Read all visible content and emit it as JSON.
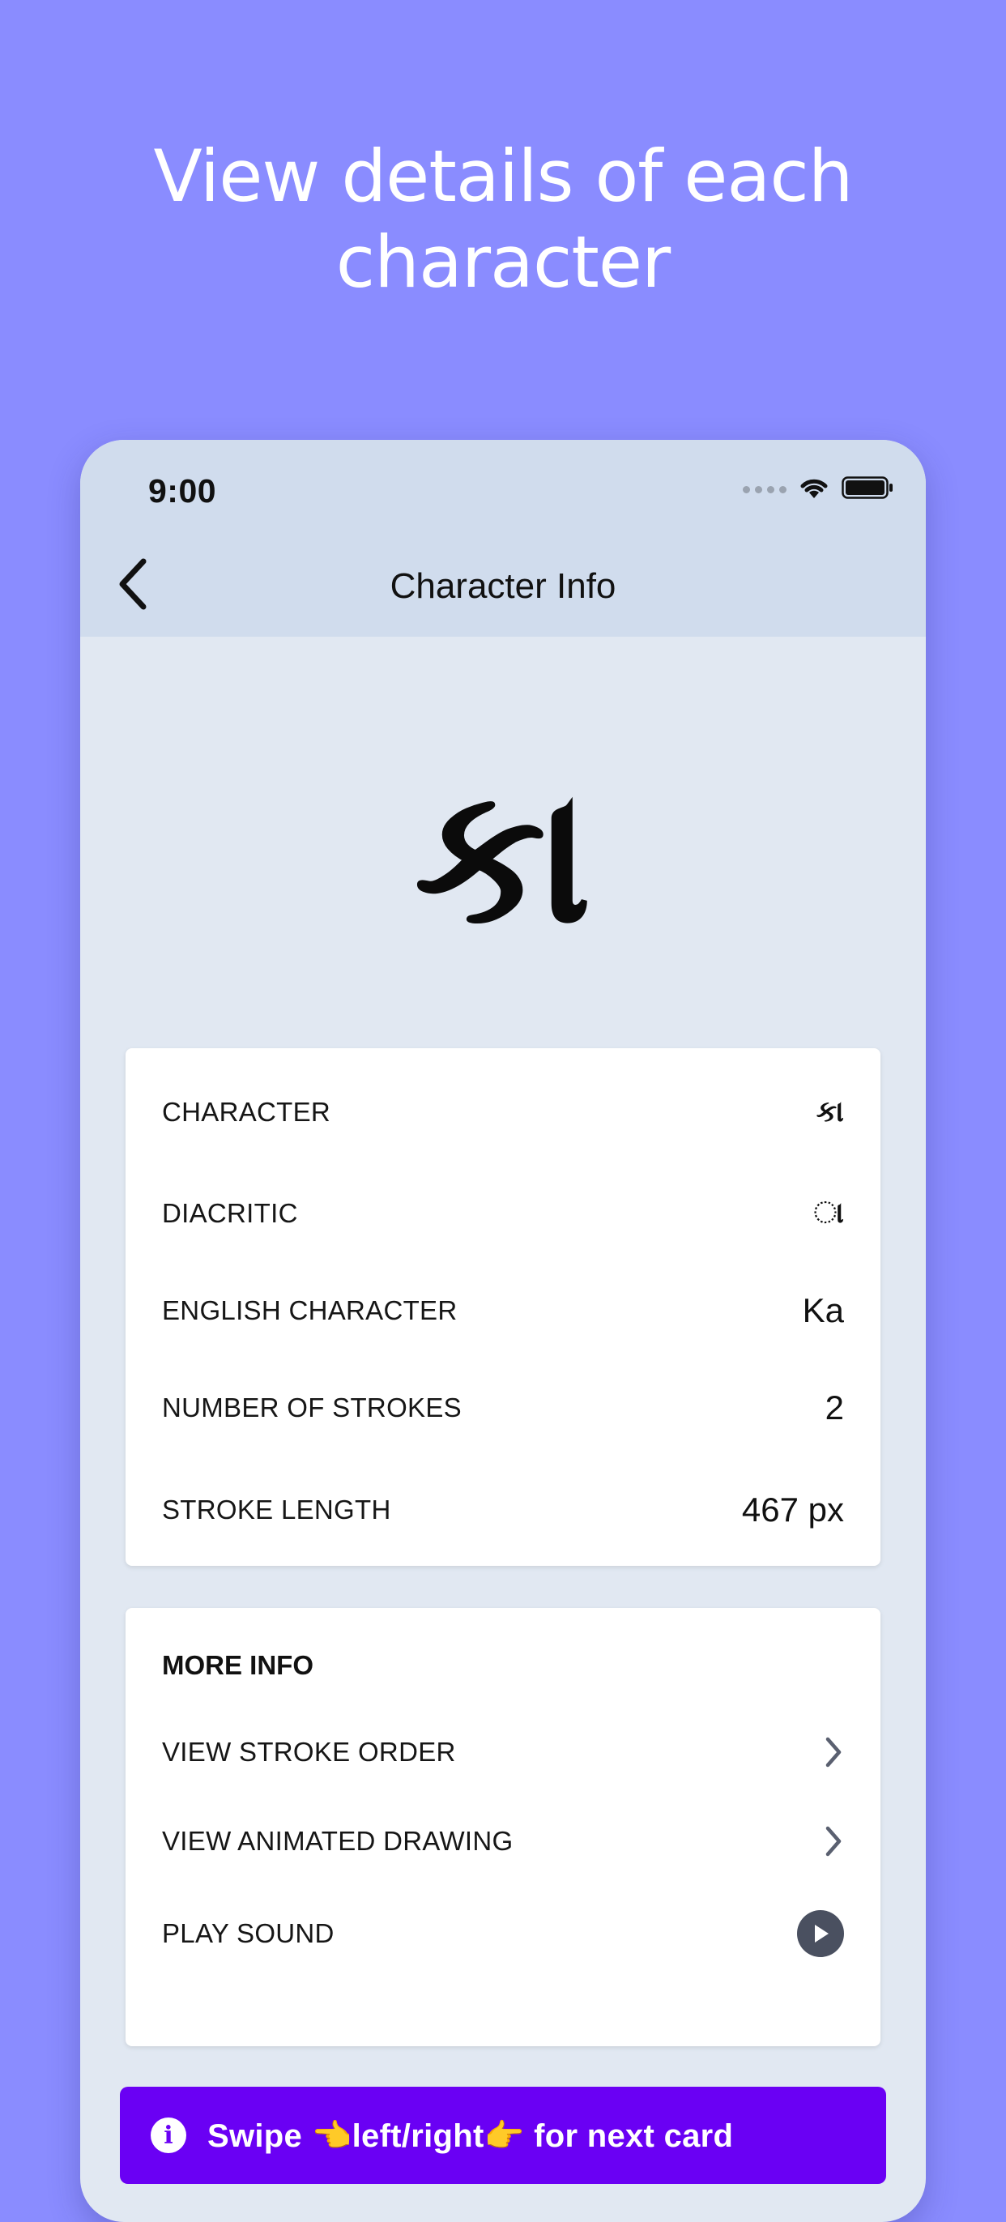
{
  "promo": {
    "line1": "View details of each",
    "line2": "character"
  },
  "status_bar": {
    "time": "9:00",
    "icons": [
      "signal-icon",
      "wifi-icon",
      "battery-icon"
    ]
  },
  "nav": {
    "back_icon": "chevron-left-icon",
    "title": "Character Info"
  },
  "hero": {
    "glyph": "કા"
  },
  "details": [
    {
      "label": "CHARACTER",
      "value": "કા"
    },
    {
      "label": "DIACRITIC",
      "value": "◌ા"
    },
    {
      "label": "ENGLISH CHARACTER",
      "value": "Ka"
    },
    {
      "label": "NUMBER OF STROKES",
      "value": "2"
    },
    {
      "label": "STROKE LENGTH",
      "value": "467 px"
    }
  ],
  "more_info": {
    "heading": "MORE INFO",
    "items": [
      {
        "label": "VIEW STROKE ORDER",
        "icon": "chevron-right-icon"
      },
      {
        "label": "VIEW ANIMATED DRAWING",
        "icon": "chevron-right-icon"
      },
      {
        "label": "PLAY SOUND",
        "icon": "play-icon"
      }
    ]
  },
  "toast": {
    "icon": "info-icon",
    "text": "Swipe 👈left/right👉 for next card"
  },
  "colors": {
    "background": "#8a8cff",
    "nav_bar": "#d0dced",
    "screen": "#e1e8f2",
    "toast": "#6a00f4"
  }
}
